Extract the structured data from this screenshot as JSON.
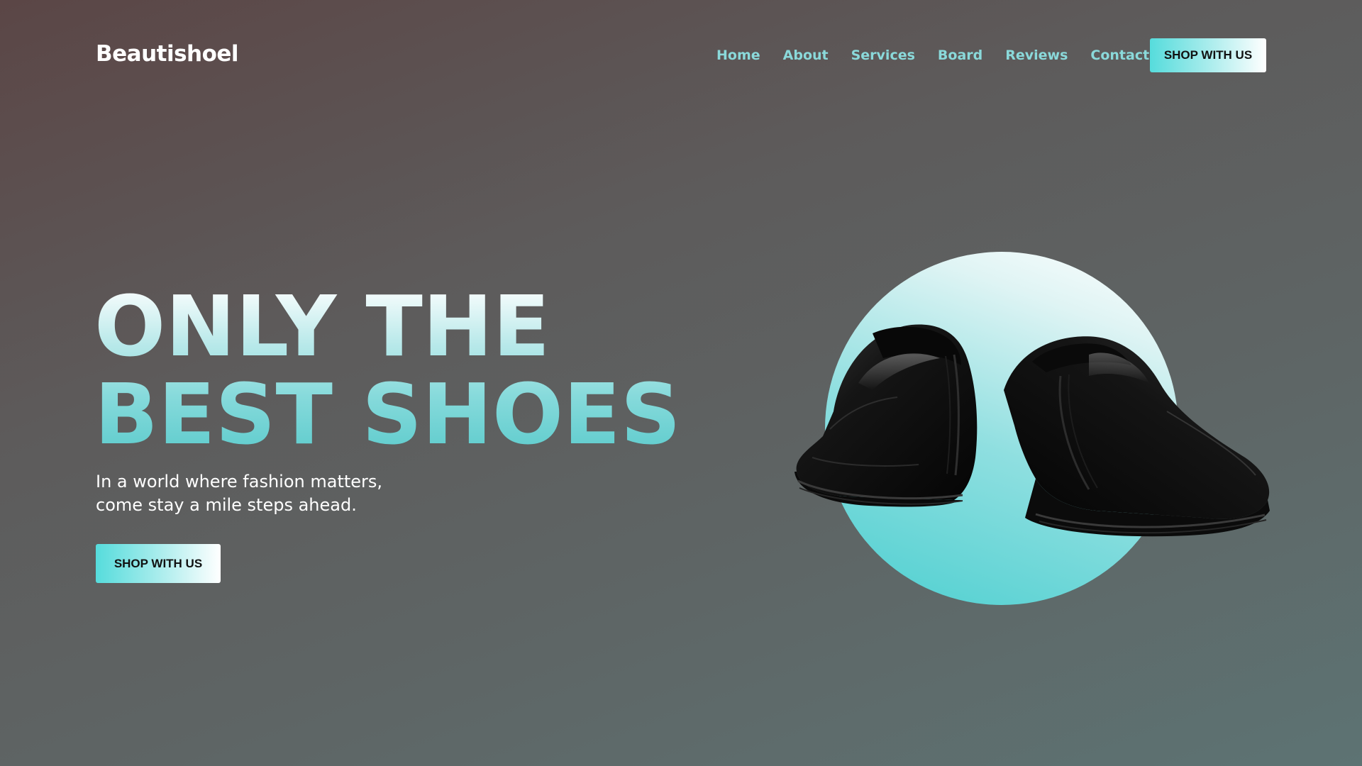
{
  "header": {
    "logo": "Beautishoel",
    "nav": [
      {
        "label": "Home"
      },
      {
        "label": "About"
      },
      {
        "label": "Services"
      },
      {
        "label": "Board"
      },
      {
        "label": "Reviews"
      },
      {
        "label": "Contact"
      }
    ],
    "cta_label": "SHOP WITH US"
  },
  "hero": {
    "headline_line1": "ONLY THE",
    "headline_line2": "BEST SHOES",
    "subtext_line1": "In a world where fashion matters,",
    "subtext_line2": "come stay a mile steps ahead.",
    "cta_label": "SHOP WITH US",
    "image_icon": "black-leather-loafers-image"
  },
  "colors": {
    "accent": "#5ccbcc",
    "nav_link": "#8ad9da",
    "background_top_left": "#5b4646",
    "background_bottom_right": "#5d7373"
  }
}
